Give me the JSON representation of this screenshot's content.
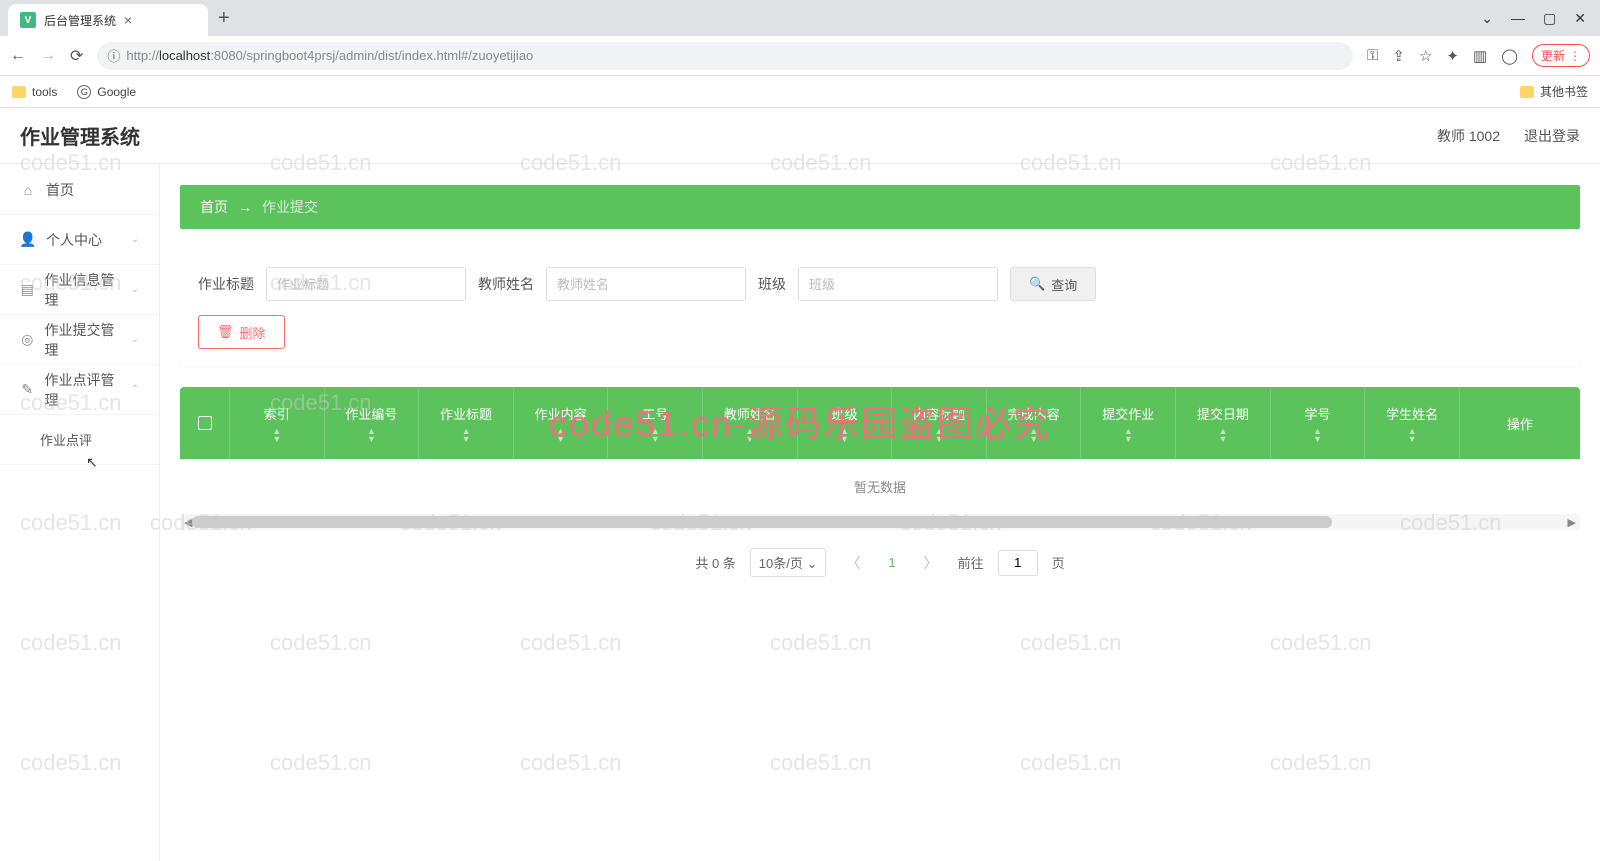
{
  "browser": {
    "tab_title": "后台管理系统",
    "url_prefix": "http://",
    "url_host": "localhost",
    "url_rest": ":8080/springboot4prsj/admin/dist/index.html#/zuoyetijiao",
    "bookmarks": {
      "tools": "tools",
      "google": "Google",
      "other": "其他书签"
    },
    "update": "更新"
  },
  "header": {
    "app_title": "作业管理系统",
    "user_role": "教师 1002",
    "logout": "退出登录"
  },
  "sidebar": {
    "home": "首页",
    "profile": "个人中心",
    "hw_info": "作业信息管理",
    "hw_submit": "作业提交管理",
    "hw_review": "作业点评管理",
    "hw_review_sub": "作业点评"
  },
  "breadcrumb": {
    "home": "首页",
    "arrow": "→",
    "current": "作业提交"
  },
  "search": {
    "title_label": "作业标题",
    "title_ph": "作业标题",
    "teacher_label": "教师姓名",
    "teacher_ph": "教师姓名",
    "class_label": "班级",
    "class_ph": "班级",
    "query_btn": "查询",
    "delete_btn": "删除"
  },
  "table": {
    "columns": [
      "索引",
      "作业编号",
      "作业标题",
      "作业内容",
      "工号",
      "教师姓名",
      "班级",
      "内容标题",
      "完成内容",
      "提交作业",
      "提交日期",
      "学号",
      "学生姓名",
      "操作"
    ],
    "empty": "暂无数据"
  },
  "pagination": {
    "total": "共 0 条",
    "page_size": "10条/页",
    "current": "1",
    "jump_label": "前往",
    "jump_value": "1",
    "page_suffix": "页"
  },
  "watermark_text": "code51.cn",
  "watermark_big": "code51.cn-源码乐园盗图必究"
}
